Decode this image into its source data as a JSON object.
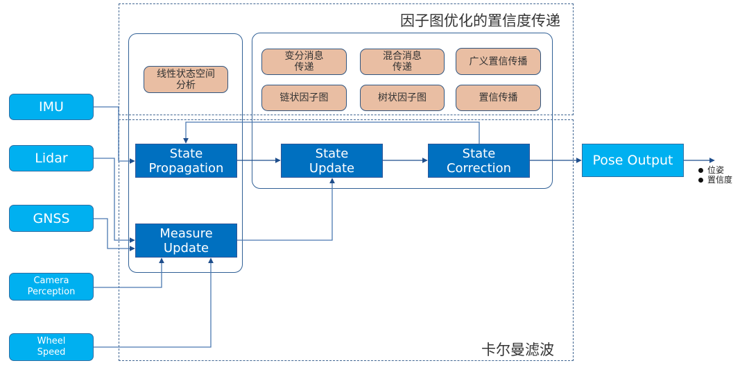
{
  "frames": {
    "factor_graph_title": "因子图优化的置信度传递",
    "kalman_title": "卡尔曼滤波"
  },
  "analysis_box": "线性状态空间\n分析",
  "factor_methods": [
    "变分消息\n传递",
    "混合消息\n传递",
    "广义置信传播",
    "链状因子图",
    "树状因子图",
    "置信传播"
  ],
  "process_blocks": {
    "state_propagation": "State\nPropagation",
    "state_update": "State\nUpdate",
    "state_correction": "State\nCorrection",
    "measure_update": "Measure\nUpdate"
  },
  "inputs": {
    "imu": "IMU",
    "lidar": "Lidar",
    "gnss": "GNSS",
    "camera": "Camera\nPerception",
    "wheel": "Wheel\nSpeed"
  },
  "output": {
    "label": "Pose Output",
    "items": [
      "位姿",
      "置信度"
    ]
  },
  "colors": {
    "input_fill": "#00b0f0",
    "process_fill": "#0070c0",
    "method_fill": "#e9bea3",
    "line": "#2f5597"
  }
}
